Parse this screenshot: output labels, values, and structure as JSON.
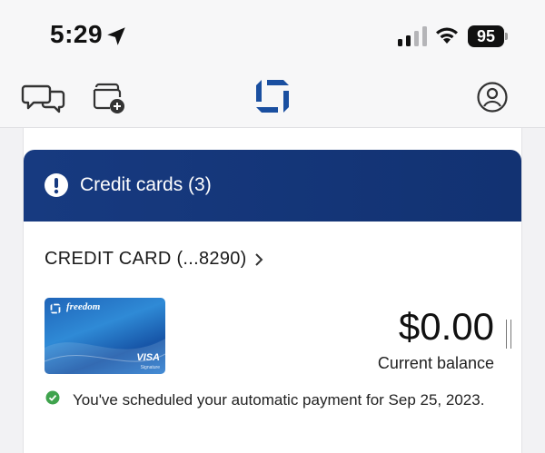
{
  "status_bar": {
    "time": "5:29",
    "battery": "95",
    "icons": [
      "location-arrow-icon",
      "cellular-signal-icon",
      "wifi-icon",
      "battery-icon"
    ]
  },
  "nav": {
    "icons": [
      "chat-icon",
      "wallet-add-icon",
      "chase-logo-icon",
      "profile-icon"
    ],
    "brand_color": "#1a4fa0"
  },
  "alert": {
    "title": "Credit cards (3)",
    "icon": "exclamation-icon",
    "background": "#173a80"
  },
  "account": {
    "label": "CREDIT CARD (...8290)",
    "card_brand": "freedom",
    "card_network": "VISA",
    "card_network_sub": "Signature",
    "balance": "$0.00",
    "balance_label": "Current balance"
  },
  "payment": {
    "message": "You've scheduled your automatic payment for Sep 25, 2023.",
    "status_color": "#3fa34d"
  }
}
